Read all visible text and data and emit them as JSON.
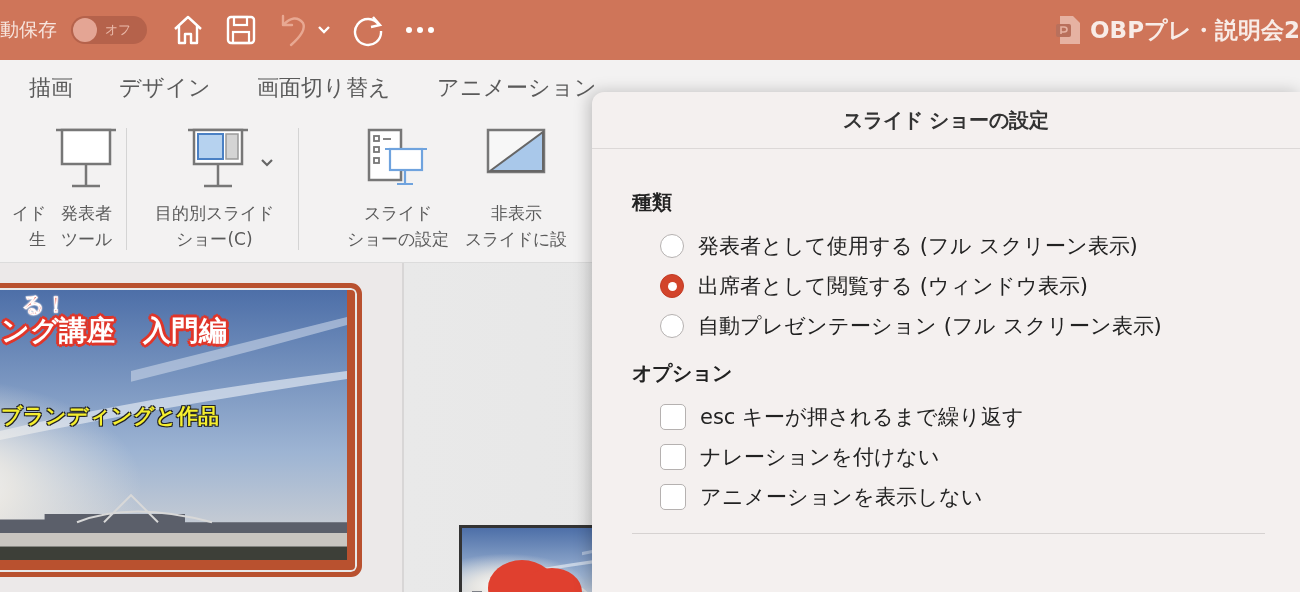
{
  "title_bar": {
    "autosave_label": "動保存",
    "autosave_toggle": {
      "label": "オフ",
      "on": false
    },
    "toolbar_icons": [
      {
        "kind": "home",
        "disabled": false
      },
      {
        "kind": "save",
        "disabled": false
      },
      {
        "kind": "undo",
        "disabled": true
      },
      {
        "kind": "caret",
        "disabled": false
      },
      {
        "kind": "redo",
        "disabled": false
      },
      {
        "kind": "more",
        "disabled": false
      }
    ],
    "document_title": "OBPプレ・説明会2"
  },
  "ribbon_tabs": [
    {
      "label": "描画"
    },
    {
      "label": "デザイン"
    },
    {
      "label": "画面切り替え"
    },
    {
      "label": "アニメーション"
    }
  ],
  "ribbon_buttons": [
    {
      "kind": "partial",
      "label_lines": [
        "イド",
        "生"
      ]
    },
    {
      "kind": "presenter",
      "label_lines": [
        "発表者",
        "ツール"
      ]
    },
    {
      "kind": "separator"
    },
    {
      "kind": "custom",
      "dropdown": true,
      "label_lines": [
        "目的別スライド",
        "ショー(C)"
      ]
    },
    {
      "kind": "separator"
    },
    {
      "kind": "setup",
      "label_lines": [
        "スライド",
        "ショーの設定"
      ]
    },
    {
      "kind": "hide",
      "label_lines": [
        "非表示",
        "スライドに設"
      ]
    }
  ],
  "slide_thumbnails": [
    {
      "selected": true,
      "lines": [
        {
          "kind": "subtitle",
          "text": "る！"
        },
        {
          "kind": "title",
          "text": "ング講座　入門編"
        },
        {
          "kind": "caption",
          "text": "ブランディングと作品"
        }
      ]
    },
    {
      "selected": false
    }
  ],
  "dialog": {
    "title": "スライド ショーの設定",
    "sections": [
      {
        "heading": "種類",
        "kind": "radio",
        "options": [
          {
            "label": "発表者として使用する (フル スクリーン表示)",
            "selected": false
          },
          {
            "label": "出席者として閲覧する (ウィンドウ表示)",
            "selected": true
          },
          {
            "label": "自動プレゼンテーション (フル スクリーン表示)",
            "selected": false
          }
        ]
      },
      {
        "heading": "オプション",
        "kind": "checkbox",
        "options": [
          {
            "label": "esc キーが押されるまで繰り返す",
            "checked": false
          },
          {
            "label": "ナレーションを付けない",
            "checked": false
          },
          {
            "label": "アニメーションを表示しない",
            "checked": false
          }
        ]
      }
    ]
  }
}
